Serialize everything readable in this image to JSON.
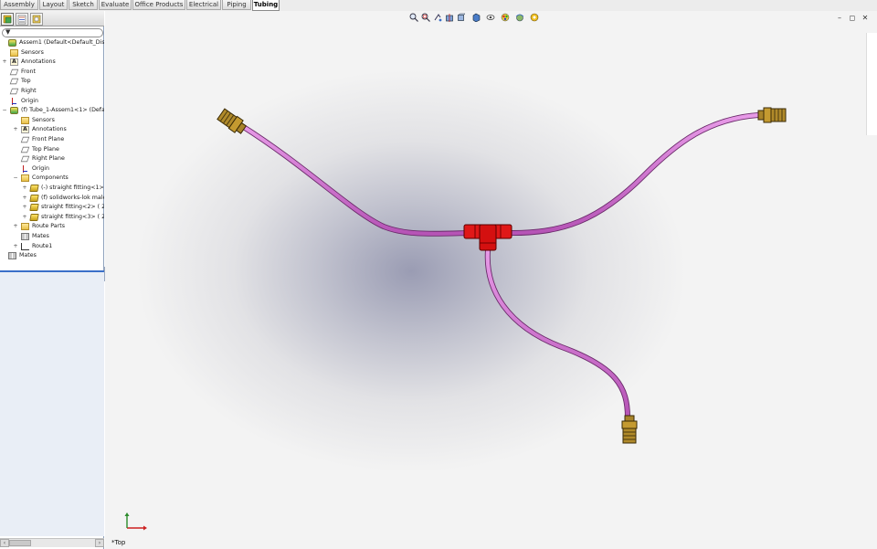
{
  "tabs": [
    {
      "label": "Assembly",
      "active": false
    },
    {
      "label": "Layout",
      "active": false
    },
    {
      "label": "Sketch",
      "active": false
    },
    {
      "label": "Evaluate",
      "active": false
    },
    {
      "label": "Office Products",
      "active": false
    },
    {
      "label": "Electrical",
      "active": false
    },
    {
      "label": "Piping",
      "active": false
    },
    {
      "label": "Tubing",
      "active": true
    }
  ],
  "panel": {
    "manager_tabs": [
      "feature-manager-icon",
      "property-manager-icon",
      "configuration-manager-icon"
    ],
    "expand_arrow": "»",
    "filter_label": "▼"
  },
  "tree": [
    {
      "label": "Assem1  (Default<Default_Display S",
      "icon": "asm",
      "indent": 0,
      "expander": ""
    },
    {
      "label": "Sensors",
      "icon": "folder",
      "indent": 1,
      "expander": ""
    },
    {
      "label": "Annotations",
      "icon": "a",
      "indent": 1,
      "expander": "+"
    },
    {
      "label": "Front",
      "icon": "plane",
      "indent": 1,
      "expander": ""
    },
    {
      "label": "Top",
      "icon": "plane",
      "indent": 1,
      "expander": ""
    },
    {
      "label": "Right",
      "icon": "plane",
      "indent": 1,
      "expander": ""
    },
    {
      "label": "Origin",
      "icon": "origin",
      "indent": 1,
      "expander": ""
    },
    {
      "label": "(f) Tube_1-Assem1<1> (Default",
      "icon": "asm",
      "indent": 1,
      "expander": "−"
    },
    {
      "label": "Sensors",
      "icon": "folder",
      "indent": 2,
      "expander": ""
    },
    {
      "label": "Annotations",
      "icon": "a",
      "indent": 2,
      "expander": "+"
    },
    {
      "label": "Front Plane",
      "icon": "plane",
      "indent": 2,
      "expander": ""
    },
    {
      "label": "Top Plane",
      "icon": "plane",
      "indent": 2,
      "expander": ""
    },
    {
      "label": "Right Plane",
      "icon": "plane",
      "indent": 2,
      "expander": ""
    },
    {
      "label": "Origin",
      "icon": "origin",
      "indent": 2,
      "expander": ""
    },
    {
      "label": "Components",
      "icon": "folder",
      "indent": 2,
      "expander": "−"
    },
    {
      "label": "(-) straight fitting<1> (",
      "icon": "part",
      "indent": 3,
      "expander": "+"
    },
    {
      "label": "(f) solidworks-lok male b",
      "icon": "part",
      "indent": 3,
      "expander": "+"
    },
    {
      "label": "straight fitting<2> ( 25",
      "icon": "part",
      "indent": 3,
      "expander": "+"
    },
    {
      "label": "straight fitting<3> ( 25",
      "icon": "part",
      "indent": 3,
      "expander": "+"
    },
    {
      "label": "Route Parts",
      "icon": "folder",
      "indent": 2,
      "expander": "+"
    },
    {
      "label": "Mates",
      "icon": "mates",
      "indent": 2,
      "expander": ""
    },
    {
      "label": "Route1",
      "icon": "route",
      "indent": 2,
      "expander": "+"
    },
    {
      "label": "Mates",
      "icon": "mates",
      "indent": 0,
      "expander": ""
    }
  ],
  "heads_up_toolbar": [
    "zoom-to-fit-icon",
    "zoom-area-icon",
    "previous-view-icon",
    "section-view-icon",
    "view-orientation-icon",
    "display-style-icon",
    "hide-show-items-icon",
    "edit-appearance-icon",
    "apply-scene-icon",
    "view-settings-icon"
  ],
  "window_controls": {
    "minimize": "–",
    "restore": "◻",
    "close": "✕"
  },
  "viewport": {
    "view_label": "*Top",
    "colors": {
      "tube": "#d678d6",
      "tee": "#e01818",
      "fitting": "#b08a2a",
      "triad_x": "#cc2020",
      "triad_y": "#2a8a2a"
    }
  }
}
